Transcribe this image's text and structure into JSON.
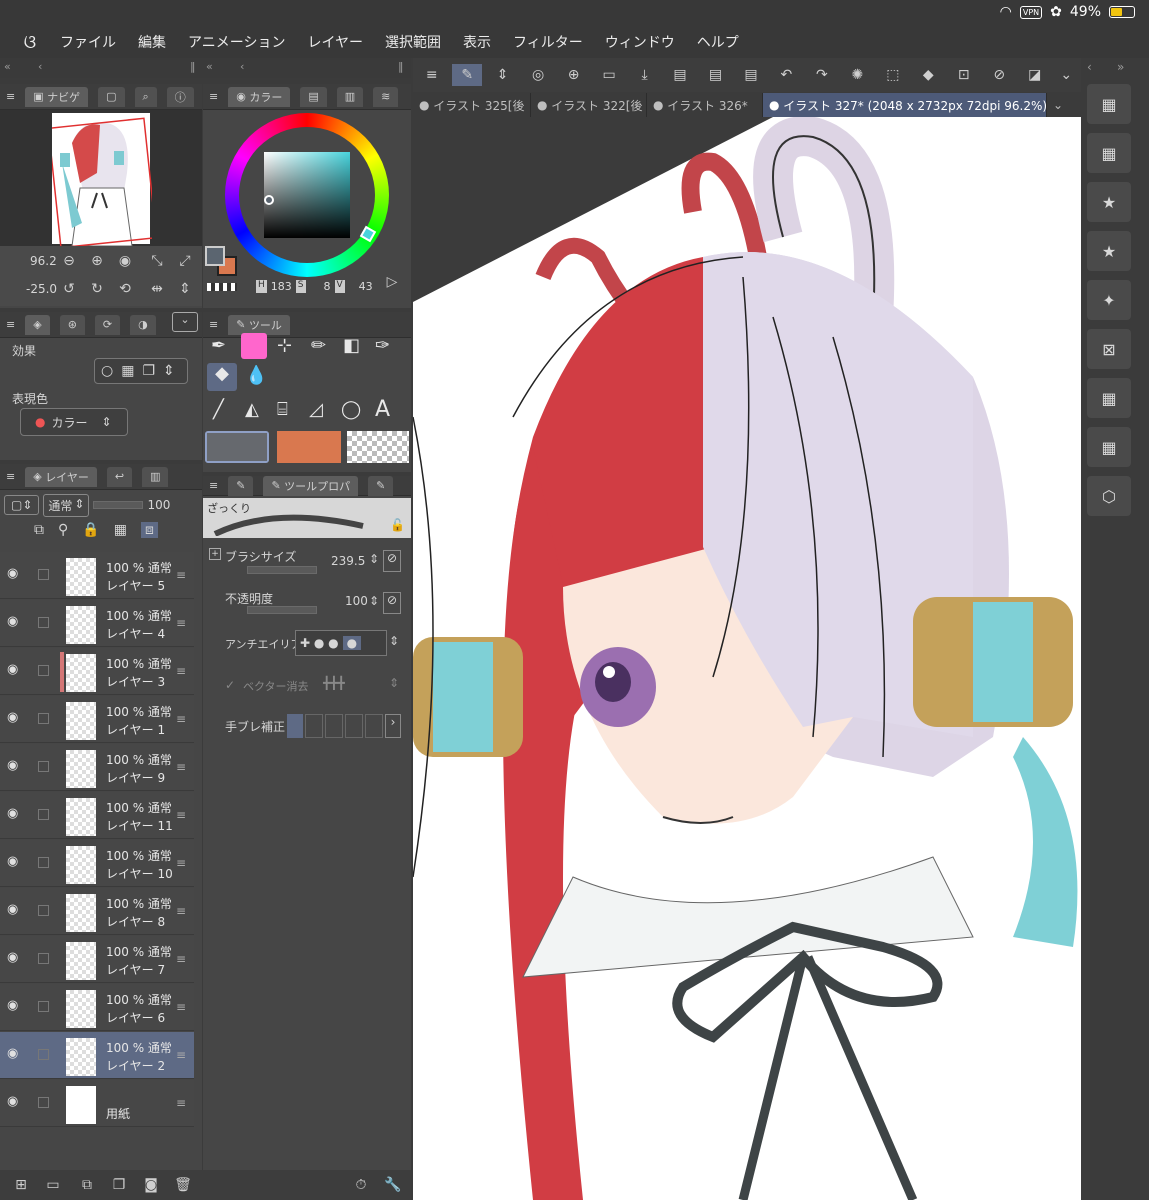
{
  "status": {
    "battery": "49%",
    "vpn": "VPN"
  },
  "menu": [
    "ファイル",
    "編集",
    "アニメーション",
    "レイヤー",
    "選択範囲",
    "表示",
    "フィルター",
    "ウィンドウ",
    "ヘルプ"
  ],
  "nav": {
    "tab": "ナビゲ",
    "zoom": "96.2",
    "rotate": "-25.0"
  },
  "color": {
    "tab": "カラー",
    "h_label": "H",
    "h": "183",
    "s_label": "S",
    "s": "8",
    "v_label": "V",
    "v": "43",
    "main": "#5b6570",
    "sub": "#d9784f"
  },
  "effect": {
    "label": "効果",
    "expr_label": "表現色",
    "expr_value": "カラー"
  },
  "tool": {
    "tab": "ツール",
    "swatch_main": "#66696e",
    "swatch_sub": "#d9784f"
  },
  "layer_panel": {
    "tab": "レイヤー",
    "blend": "通常",
    "opacity": "100"
  },
  "layers": [
    {
      "mode": "100 % 通常",
      "name": "レイヤー 5"
    },
    {
      "mode": "100 % 通常",
      "name": "レイヤー 4"
    },
    {
      "mode": "100 % 通常",
      "name": "レイヤー 3"
    },
    {
      "mode": "100 % 通常",
      "name": "レイヤー 1"
    },
    {
      "mode": "100 % 通常",
      "name": "レイヤー 9"
    },
    {
      "mode": "100 % 通常",
      "name": "レイヤー 11"
    },
    {
      "mode": "100 % 通常",
      "name": "レイヤー 10"
    },
    {
      "mode": "100 % 通常",
      "name": "レイヤー 8"
    },
    {
      "mode": "100 % 通常",
      "name": "レイヤー 7"
    },
    {
      "mode": "100 % 通常",
      "name": "レイヤー 6"
    },
    {
      "mode": "100 % 通常",
      "name": "レイヤー 2"
    },
    {
      "mode": "",
      "name": "用紙"
    }
  ],
  "props": {
    "tab": "ツールプロパ",
    "brush_name": "ざっくり",
    "brush_size_label": "ブラシサイズ",
    "brush_size": "239.5",
    "opacity_label": "不透明度",
    "opacity": "100",
    "aa_label": "アンチエイリア",
    "vector_label": "ベクター消去",
    "stabilizer_label": "手ブレ補正"
  },
  "doc_tabs": [
    "イラスト 325[後",
    "イラスト 322[後",
    "イラスト 326*",
    "イラスト 327* (2048 x 2732px 72dpi 96.2%)"
  ],
  "toolbar_icons": [
    "menu-icon",
    "eyedropper-icon",
    "swap-icon",
    "spiral-icon",
    "new-canvas-icon",
    "open-icon",
    "save-icon",
    "jpg-icon",
    "png-icon",
    "psd-icon",
    "undo-icon",
    "redo-icon",
    "loading-icon",
    "selection-icon",
    "fill-icon",
    "transform-icon",
    "deselect-icon",
    "invert-icon"
  ]
}
